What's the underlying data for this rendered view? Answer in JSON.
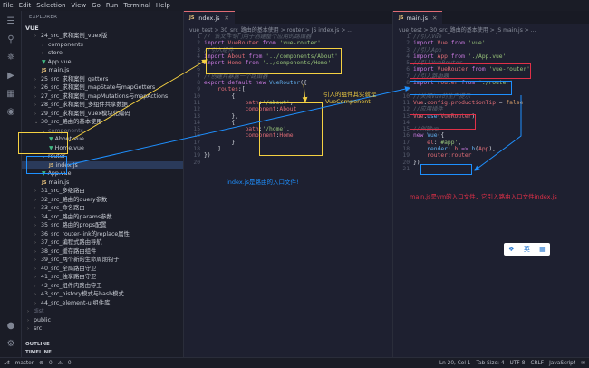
{
  "menu": [
    "File",
    "Edit",
    "Selection",
    "View",
    "Go",
    "Run",
    "Terminal",
    "Help"
  ],
  "sidebar": {
    "header": "EXPLORER",
    "project": "VUE",
    "items": [
      {
        "label": "24_src_求和案例_vuex版",
        "indent": 1,
        "type": "folder",
        "dim": false
      },
      {
        "label": "components",
        "indent": 2,
        "type": "folder",
        "dim": false
      },
      {
        "label": "store",
        "indent": 2,
        "type": "folder",
        "dim": false
      },
      {
        "label": "App.vue",
        "indent": 2,
        "type": "vue",
        "dim": false
      },
      {
        "label": "main.js",
        "indent": 2,
        "type": "js",
        "dim": false
      },
      {
        "label": "25_src_求和案例_getters",
        "indent": 1,
        "type": "folder",
        "dim": false
      },
      {
        "label": "26_src_求和案例_mapState与mapGetters",
        "indent": 1,
        "type": "folder",
        "dim": false
      },
      {
        "label": "27_src_求和案例_mapMutations与mapActions",
        "indent": 1,
        "type": "folder",
        "dim": false
      },
      {
        "label": "28_src_求和案例_多组件共享数据",
        "indent": 1,
        "type": "folder",
        "dim": false
      },
      {
        "label": "29_src_求和案例_vuex模块化编码",
        "indent": 1,
        "type": "folder",
        "dim": false
      },
      {
        "label": "30_src_路由的基本使用",
        "indent": 1,
        "type": "folder-open",
        "dim": false
      },
      {
        "label": "components",
        "indent": 2,
        "type": "folder-open",
        "dim": true
      },
      {
        "label": "About.vue",
        "indent": 3,
        "type": "vue",
        "dim": false
      },
      {
        "label": "Home.vue",
        "indent": 3,
        "type": "vue",
        "dim": false
      },
      {
        "label": "router",
        "indent": 2,
        "type": "folder-open",
        "dim": false
      },
      {
        "label": "index.js",
        "indent": 3,
        "type": "js",
        "dim": false,
        "sel": true
      },
      {
        "label": "App.vue",
        "indent": 2,
        "type": "vue",
        "dim": false
      },
      {
        "label": "main.js",
        "indent": 2,
        "type": "js",
        "dim": false
      },
      {
        "label": "31_src_多级路由",
        "indent": 1,
        "type": "folder",
        "dim": false
      },
      {
        "label": "32_src_路由的query参数",
        "indent": 1,
        "type": "folder",
        "dim": false
      },
      {
        "label": "33_src_命名路由",
        "indent": 1,
        "type": "folder",
        "dim": false
      },
      {
        "label": "34_src_路由的params参数",
        "indent": 1,
        "type": "folder",
        "dim": false
      },
      {
        "label": "35_src_路由的props配置",
        "indent": 1,
        "type": "folder",
        "dim": false
      },
      {
        "label": "36_src_router-link的replace属性",
        "indent": 1,
        "type": "folder",
        "dim": false
      },
      {
        "label": "37_src_编程式路由导航",
        "indent": 1,
        "type": "folder",
        "dim": false
      },
      {
        "label": "38_src_缓存路由组件",
        "indent": 1,
        "type": "folder",
        "dim": false
      },
      {
        "label": "39_src_两个新的生命周期钩子",
        "indent": 1,
        "type": "folder",
        "dim": false
      },
      {
        "label": "40_src_全局路由守卫",
        "indent": 1,
        "type": "folder",
        "dim": false
      },
      {
        "label": "41_src_独享路由守卫",
        "indent": 1,
        "type": "folder",
        "dim": false
      },
      {
        "label": "42_src_组件内路由守卫",
        "indent": 1,
        "type": "folder",
        "dim": false
      },
      {
        "label": "43_src_history模式与hash模式",
        "indent": 1,
        "type": "folder",
        "dim": false
      },
      {
        "label": "44_src_element-ui组件库",
        "indent": 1,
        "type": "folder",
        "dim": false
      },
      {
        "label": "dist",
        "indent": 0,
        "type": "folder",
        "dim": true
      },
      {
        "label": "public",
        "indent": 0,
        "type": "folder",
        "dim": false
      },
      {
        "label": "src",
        "indent": 0,
        "type": "folder",
        "dim": false
      }
    ],
    "outline": "OUTLINE",
    "timeline": "TIMELINE"
  },
  "editor1": {
    "tab": "index.js",
    "breadcrumb": "vue_test > 30_src_路由的基本使用 > router > JS index.js > ...",
    "lines": [
      {
        "n": "1",
        "html": "<span class='c'>// 该文件专门用于创建整个应用的路由器</span>"
      },
      {
        "n": "2",
        "html": "<span class='k'>import</span> <span class='p'>VueRouter</span> <span class='k'>from</span> <span class='s'>'vue-router'</span>"
      },
      {
        "n": "3",
        "html": "<span class='c'>//引入组件</span>"
      },
      {
        "n": "4",
        "html": "<span class='k'>import</span> <span class='p'>About</span> <span class='k'>from</span> <span class='s'>'../components/About'</span>"
      },
      {
        "n": "5",
        "html": "<span class='k'>import</span> <span class='p'>Home</span> <span class='k'>from</span> <span class='s'>'../components/Home'</span>"
      },
      {
        "n": "6",
        "html": ""
      },
      {
        "n": "7",
        "html": "<span class='c'>//创建并暴露一个路由器</span>"
      },
      {
        "n": "8",
        "html": "<span class='k'>export default new</span> <span class='f'>VueRouter</span>({"
      },
      {
        "n": "9",
        "html": "    <span class='p'>routes</span>:["
      },
      {
        "n": "10",
        "html": "        {"
      },
      {
        "n": "11",
        "html": "            <span class='p'>path</span>:<span class='s'>'/about'</span>,"
      },
      {
        "n": "12",
        "html": "            <span class='p'>component</span>:<span class='p'>About</span>"
      },
      {
        "n": "13",
        "html": "        },"
      },
      {
        "n": "14",
        "html": "        {"
      },
      {
        "n": "15",
        "html": "            <span class='p'>path</span>:<span class='s'>'/home'</span>,"
      },
      {
        "n": "16",
        "html": "            <span class='p'>component</span>:<span class='p'>Home</span>"
      },
      {
        "n": "17",
        "html": "        }"
      },
      {
        "n": "18",
        "html": "    ]"
      },
      {
        "n": "19",
        "html": "})"
      },
      {
        "n": "20",
        "html": ""
      }
    ]
  },
  "editor2": {
    "tab": "main.js",
    "breadcrumb": "vue_test > 30_src_路由的基本使用 > JS main.js > ...",
    "lines": [
      {
        "n": "1",
        "html": "<span class='c'>//引入Vue</span>"
      },
      {
        "n": "2",
        "html": "<span class='k'>import</span> <span class='p'>Vue</span> <span class='k'>from</span> <span class='s'>'vue'</span>"
      },
      {
        "n": "3",
        "html": "<span class='c'>//引入App</span>"
      },
      {
        "n": "4",
        "html": "<span class='k'>import</span> <span class='p'>App</span> <span class='k'>from</span> <span class='s'>'./App.vue'</span>"
      },
      {
        "n": "5",
        "html": "<span class='c'>//引入VueRouter</span>"
      },
      {
        "n": "6",
        "html": "<span class='k'>import</span> <span class='p'>VueRouter</span> <span class='k'>from</span> <span class='s'>'vue-router'</span>"
      },
      {
        "n": "7",
        "html": "<span class='c'>//引入路由器</span>"
      },
      {
        "n": "8",
        "html": "<span class='k'>import</span> <span class='p'>router</span> <span class='k'>from</span> <span class='s'>'./router'</span>"
      },
      {
        "n": "9",
        "html": ""
      },
      {
        "n": "10",
        "html": "<span class='c'>//关闭Vue的生产提示</span>"
      },
      {
        "n": "11",
        "html": "<span class='p'>Vue</span>.<span class='p'>config</span>.<span class='p'>productionTip</span> = <span class='n'>false</span>"
      },
      {
        "n": "12",
        "html": "<span class='c'>//应用插件</span>"
      },
      {
        "n": "13",
        "html": "<span class='p'>Vue</span>.<span class='f'>use</span>(<span class='p'>VueRouter</span>)"
      },
      {
        "n": "14",
        "html": ""
      },
      {
        "n": "15",
        "html": "<span class='c'>//创建vm</span>"
      },
      {
        "n": "16",
        "html": "<span class='k'>new</span> <span class='f'>Vue</span>({"
      },
      {
        "n": "17",
        "html": "    <span class='p'>el</span>:<span class='s'>'#app'</span>,"
      },
      {
        "n": "18",
        "html": "    <span class='f'>render</span>: <span class='p'>h</span> <span class='k'>=&gt;</span> <span class='f'>h</span>(<span class='p'>App</span>),"
      },
      {
        "n": "19",
        "html": "    <span class='p'>router</span>:<span class='p'>router</span>"
      },
      {
        "n": "20",
        "html": "})"
      },
      {
        "n": "21",
        "html": ""
      }
    ]
  },
  "annotations": {
    "component_note_1": "引入的组件其实就是",
    "component_note_2": "VueComponent",
    "index_note": "index.js是路由的入口文件!",
    "main_note": "main.js是vm的入口文件，它引入路由入口文件index.js"
  },
  "widget": {
    "a": "英",
    "b": "·"
  },
  "statusbar": {
    "branch": "master",
    "errors": "0",
    "warnings": "0",
    "position": "Ln 20, Col 1",
    "tab": "Tab Size: 4",
    "encoding": "UTF-8",
    "eol": "CRLF",
    "lang": "JavaScript"
  },
  "colors": {
    "yellow": "#f5d142",
    "blue": "#1e90ff",
    "red": "#e03048"
  }
}
